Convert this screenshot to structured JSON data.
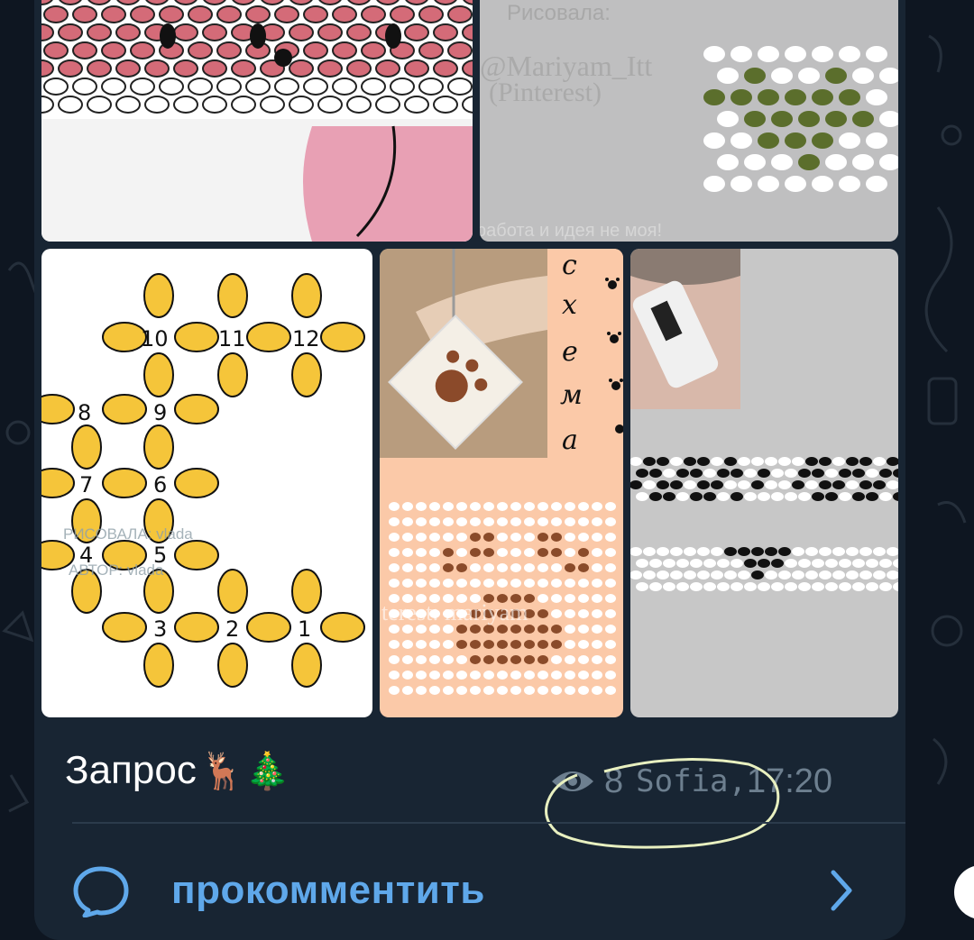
{
  "post": {
    "caption": "Запрос",
    "caption_emoji": "🦌🎄",
    "views": "8",
    "author": "Sofia,",
    "time": "17:20"
  },
  "comments": {
    "label": "прокомментить"
  },
  "media": {
    "tile2_credit": "Рисовала:",
    "tile2_author": "@Mariyam_Itt",
    "tile2_source": "(Pinterest)",
    "tile2_footer": "работа и идея не моя!",
    "tile3_numbers": [
      "10",
      "11",
      "12",
      "8",
      "9",
      "7",
      "6",
      "4",
      "5",
      "3",
      "2",
      "1"
    ],
    "tile3_watermark1": "РИСОВАЛА: vlada",
    "tile3_watermark2": "АВТОР: vlada",
    "tile4_word": [
      "с",
      "х",
      "е",
      "м",
      "а"
    ],
    "tile4_watermark": "terest: mariyam"
  },
  "colors": {
    "background": "#0e1621",
    "bubble": "#182533",
    "accent": "#5fa8ea",
    "meta": "#6d7f8f",
    "bead_yellow": "#f5c53a",
    "bead_pink": "#d46b78",
    "bead_green": "#5b6e2c",
    "bead_brown": "#8a4b2a",
    "highlight": "#e8f0c0"
  },
  "icons": [
    "eye-icon",
    "comment-bubble-icon",
    "chevron-right-icon"
  ]
}
